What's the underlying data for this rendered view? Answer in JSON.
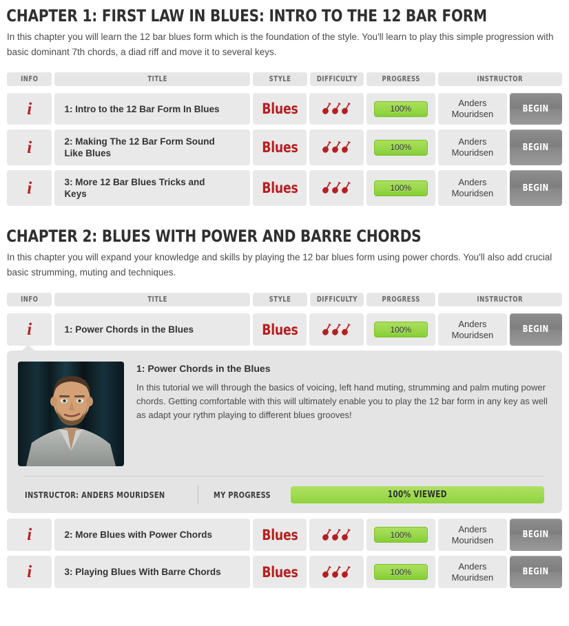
{
  "colors": {
    "accent_red": "#b51f22",
    "progress_green": "#9bd84c",
    "cell_gray": "#e9e9e9",
    "header_gray": "#e6e6e6",
    "panel_gray": "#e4e4e4",
    "begin_gray": "#868686"
  },
  "table_headers": [
    "INFO",
    "TITLE",
    "STYLE",
    "DIFFICULTY",
    "PROGRESS",
    "INSTRUCTOR"
  ],
  "icons": {
    "info": "info-icon",
    "difficulty": "guitar-icon"
  },
  "chapters": [
    {
      "title": "CHAPTER 1: FIRST LAW IN BLUES: INTRO TO THE 12 BAR FORM",
      "description": "In this chapter you will learn the 12 bar blues form which is the foundation of the style. You'll learn to play this simple progression with basic dominant 7th chords, a diad riff and move it to several keys.",
      "lessons": [
        {
          "title": "1: Intro to the 12 Bar Form In Blues",
          "style": "Blues",
          "difficulty": 3,
          "progress": "100%",
          "instructor_line1": "Anders",
          "instructor_line2": "Mouridsen",
          "begin_label": "BEGIN"
        },
        {
          "title": "2: Making The 12 Bar Form Sound Like Blues",
          "style": "Blues",
          "difficulty": 3,
          "progress": "100%",
          "instructor_line1": "Anders",
          "instructor_line2": "Mouridsen",
          "begin_label": "BEGIN"
        },
        {
          "title": "3: More 12 Bar Blues Tricks and Keys",
          "style": "Blues",
          "difficulty": 3,
          "progress": "100%",
          "instructor_line1": "Anders",
          "instructor_line2": "Mouridsen",
          "begin_label": "BEGIN"
        }
      ]
    },
    {
      "title": "CHAPTER 2: BLUES WITH POWER AND BARRE CHORDS",
      "description": "In this chapter you will expand your knowledge and skills by playing the 12 bar blues form using power chords. You'll also add crucial basic strumming, muting and techniques.",
      "lessons": [
        {
          "title": "1: Power Chords in the Blues",
          "style": "Blues",
          "difficulty": 3,
          "progress": "100%",
          "instructor_line1": "Anders",
          "instructor_line2": "Mouridsen",
          "begin_label": "BEGIN"
        },
        {
          "title": "2: More Blues with Power Chords",
          "style": "Blues",
          "difficulty": 3,
          "progress": "100%",
          "instructor_line1": "Anders",
          "instructor_line2": "Mouridsen",
          "begin_label": "BEGIN"
        },
        {
          "title": "3: Playing Blues With Barre Chords",
          "style": "Blues",
          "difficulty": 3,
          "progress": "100%",
          "instructor_line1": "Anders",
          "instructor_line2": "Mouridsen",
          "begin_label": "BEGIN"
        }
      ]
    }
  ],
  "expanded_detail": {
    "title": "1: Power Chords in the Blues",
    "description": "In this tutorial we will through the basics of voicing, left hand muting, strumming and palm muting power chords. Getting comfortable with this will ultimately enable you to play the 12 bar form in any key as well as adapt your rythm playing to different blues grooves!",
    "instructor_label": "INSTRUCTOR: ANDERS MOURIDSEN",
    "progress_label": "MY PROGRESS",
    "progress_bar_text": "100% VIEWED",
    "progress_percent": 100,
    "thumbnail_alt": "instructor-portrait"
  }
}
